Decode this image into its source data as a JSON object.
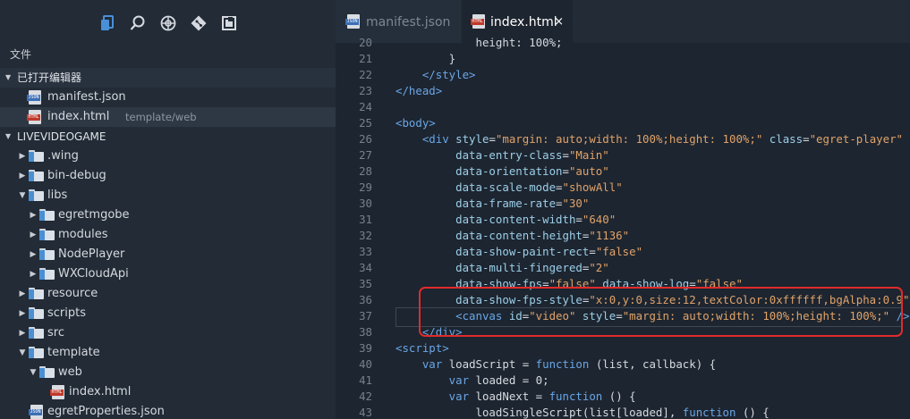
{
  "explorer": {
    "title": "文件",
    "open_editors_label": "已打开编辑器",
    "open_editors": [
      {
        "name": "manifest.json",
        "type": "json",
        "sub": ""
      },
      {
        "name": "index.html",
        "type": "html",
        "sub": "template/web"
      }
    ],
    "project_label": "LIVEVIDEOGAME",
    "tree": [
      {
        "name": ".wing",
        "kind": "folder",
        "depth": 1,
        "expanded": false
      },
      {
        "name": "bin-debug",
        "kind": "folder",
        "depth": 1,
        "expanded": false
      },
      {
        "name": "libs",
        "kind": "folder",
        "depth": 1,
        "expanded": true
      },
      {
        "name": "egretmgobe",
        "kind": "folder",
        "depth": 2,
        "expanded": false
      },
      {
        "name": "modules",
        "kind": "folder",
        "depth": 2,
        "expanded": false
      },
      {
        "name": "NodePlayer",
        "kind": "folder",
        "depth": 2,
        "expanded": false
      },
      {
        "name": "WXCloudApi",
        "kind": "folder",
        "depth": 2,
        "expanded": false
      },
      {
        "name": "resource",
        "kind": "folder",
        "depth": 1,
        "expanded": false
      },
      {
        "name": "scripts",
        "kind": "folder",
        "depth": 1,
        "expanded": false
      },
      {
        "name": "src",
        "kind": "folder",
        "depth": 1,
        "expanded": false
      },
      {
        "name": "template",
        "kind": "folder",
        "depth": 1,
        "expanded": true
      },
      {
        "name": "web",
        "kind": "folder",
        "depth": 2,
        "expanded": true
      },
      {
        "name": "index.html",
        "kind": "html",
        "depth": 3,
        "expanded": false
      },
      {
        "name": "egretProperties.json",
        "kind": "json",
        "depth": 1,
        "expanded": false
      }
    ]
  },
  "icons": [
    "files-icon",
    "search-icon",
    "debug-icon",
    "git-icon",
    "extensions-icon"
  ],
  "tabs": [
    {
      "label": "manifest.json",
      "type": "json",
      "active": false
    },
    {
      "label": "index.html",
      "type": "html",
      "active": true,
      "close": "×"
    }
  ],
  "code": [
    {
      "n": "20",
      "tokens": [
        [
          "v",
          "            height: 100%;"
        ]
      ]
    },
    {
      "n": "21",
      "tokens": [
        [
          "v",
          "        }"
        ]
      ]
    },
    {
      "n": "22",
      "tokens": [
        [
          "t",
          "    </style>"
        ]
      ]
    },
    {
      "n": "23",
      "tokens": [
        [
          "t",
          "</head>"
        ]
      ]
    },
    {
      "n": "24",
      "tokens": []
    },
    {
      "n": "25",
      "tokens": [
        [
          "t",
          "<body>"
        ]
      ]
    },
    {
      "n": "26",
      "tokens": [
        [
          "t",
          "    <div "
        ],
        [
          "a",
          "style"
        ],
        [
          "v",
          "="
        ],
        [
          "s",
          "\"margin: auto;width: 100%;height: 100%;\""
        ],
        [
          "v",
          " "
        ],
        [
          "a",
          "class"
        ],
        [
          "v",
          "="
        ],
        [
          "s",
          "\"egret-player\""
        ]
      ]
    },
    {
      "n": "27",
      "tokens": [
        [
          "a",
          "         data-entry-class"
        ],
        [
          "v",
          "="
        ],
        [
          "s",
          "\"Main\""
        ]
      ]
    },
    {
      "n": "28",
      "tokens": [
        [
          "a",
          "         data-orientation"
        ],
        [
          "v",
          "="
        ],
        [
          "s",
          "\"auto\""
        ]
      ]
    },
    {
      "n": "29",
      "tokens": [
        [
          "a",
          "         data-scale-mode"
        ],
        [
          "v",
          "="
        ],
        [
          "s",
          "\"showAll\""
        ]
      ]
    },
    {
      "n": "30",
      "tokens": [
        [
          "a",
          "         data-frame-rate"
        ],
        [
          "v",
          "="
        ],
        [
          "s",
          "\"30\""
        ]
      ]
    },
    {
      "n": "31",
      "tokens": [
        [
          "a",
          "         data-content-width"
        ],
        [
          "v",
          "="
        ],
        [
          "s",
          "\"640\""
        ]
      ]
    },
    {
      "n": "32",
      "tokens": [
        [
          "a",
          "         data-content-height"
        ],
        [
          "v",
          "="
        ],
        [
          "s",
          "\"1136\""
        ]
      ]
    },
    {
      "n": "33",
      "tokens": [
        [
          "a",
          "         data-show-paint-rect"
        ],
        [
          "v",
          "="
        ],
        [
          "s",
          "\"false\""
        ]
      ]
    },
    {
      "n": "34",
      "tokens": [
        [
          "a",
          "         data-multi-fingered"
        ],
        [
          "v",
          "="
        ],
        [
          "s",
          "\"2\""
        ]
      ]
    },
    {
      "n": "35",
      "tokens": [
        [
          "a",
          "         data-show-fps"
        ],
        [
          "v",
          "="
        ],
        [
          "s",
          "\"false\""
        ],
        [
          "v",
          " "
        ],
        [
          "a",
          "data-show-log"
        ],
        [
          "v",
          "="
        ],
        [
          "s",
          "\"false\""
        ]
      ]
    },
    {
      "n": "36",
      "tokens": [
        [
          "a",
          "         data-show-fps-style"
        ],
        [
          "v",
          "="
        ],
        [
          "s",
          "\"x:0,y:0,size:12,textColor:0xffffff,bgAlpha:0.9\""
        ],
        [
          "t",
          ">"
        ]
      ]
    },
    {
      "n": "37",
      "tokens": [
        [
          "t",
          "         <canvas "
        ],
        [
          "a",
          "id"
        ],
        [
          "v",
          "="
        ],
        [
          "s",
          "\"video\""
        ],
        [
          "v",
          " "
        ],
        [
          "a",
          "style"
        ],
        [
          "v",
          "="
        ],
        [
          "s",
          "\"margin: auto;width: 100%;height: 100%;\""
        ],
        [
          "v",
          " "
        ],
        [
          "t",
          "/>"
        ]
      ]
    },
    {
      "n": "38",
      "tokens": [
        [
          "t",
          "    </div>"
        ]
      ]
    },
    {
      "n": "39",
      "tokens": [
        [
          "t",
          "<script>"
        ]
      ]
    },
    {
      "n": "40",
      "tokens": [
        [
          "k",
          "    var "
        ],
        [
          "v",
          "loadScript = "
        ],
        [
          "k",
          "function"
        ],
        [
          "v",
          " (list, callback) {"
        ]
      ]
    },
    {
      "n": "41",
      "tokens": [
        [
          "k",
          "        var "
        ],
        [
          "v",
          "loaded = 0;"
        ]
      ]
    },
    {
      "n": "42",
      "tokens": [
        [
          "k",
          "        var "
        ],
        [
          "v",
          "loadNext = "
        ],
        [
          "k",
          "function"
        ],
        [
          "v",
          " () {"
        ]
      ]
    },
    {
      "n": "43",
      "tokens": [
        [
          "v",
          "            loadSingleScript(list[loaded], "
        ],
        [
          "k",
          "function"
        ],
        [
          "v",
          " () {"
        ]
      ]
    }
  ],
  "colors": {
    "accent": "#4a90d9",
    "highlight_box": "#e02b2b"
  }
}
